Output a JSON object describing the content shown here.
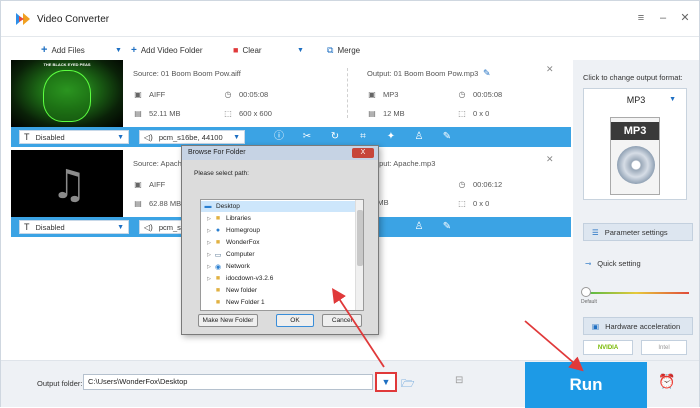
{
  "app": {
    "title": "Video Converter"
  },
  "window_controls": {
    "menu": "≡",
    "minimize": "–",
    "close": "✕"
  },
  "toolbar": {
    "add_files": "Add Files",
    "add_video_folder": "Add Video Folder",
    "clear": "Clear",
    "merge": "Merge"
  },
  "items": [
    {
      "source": "Source: 01 Boom Boom Pow.aiff",
      "src_format": "AIFF",
      "src_duration": "00:05:08",
      "src_size": "52.11 MB",
      "src_resolution": "600 x 600",
      "output": "Output: 01 Boom Boom Pow.mp3",
      "out_format": "MP3",
      "out_duration": "00:05:08",
      "out_size": "12 MB",
      "out_resolution": "0 x 0",
      "subtitle": "Disabled",
      "audio": "pcm_s16be, 44100"
    },
    {
      "source": "Source: Apache",
      "src_format": "AIFF",
      "src_size": "62.88 MB",
      "output": "Output: Apache.mp3",
      "out_size": "14 MB",
      "out_duration": "00:06:12",
      "out_resolution": "0 x 0",
      "subtitle": "Disabled",
      "audio": "pcm_s16b"
    }
  ],
  "thumb1_text": "THE BLACK EYED PEAS",
  "right_panel": {
    "label": "Click to change output format:",
    "format": "MP3",
    "parameter_settings": "Parameter settings",
    "quick_setting": "Quick setting",
    "default": "Default",
    "hardware_acceleration": "Hardware acceleration",
    "nvidia": "NVIDIA",
    "intel": "Intel"
  },
  "bottom": {
    "output_folder_label": "Output folder:",
    "output_folder_value": "C:\\Users\\WonderFox\\Desktop",
    "run": "Run"
  },
  "dialog": {
    "title": "Browse For Folder",
    "close": "X",
    "prompt": "Please select path:",
    "tree": [
      {
        "label": "Desktop",
        "indent": 0,
        "selected": true,
        "icon": "desktop-icon"
      },
      {
        "label": "Libraries",
        "indent": 1,
        "icon": "folder-icon"
      },
      {
        "label": "Homegroup",
        "indent": 1,
        "icon": "homegroup-icon"
      },
      {
        "label": "WonderFox",
        "indent": 1,
        "icon": "user-icon"
      },
      {
        "label": "Computer",
        "indent": 1,
        "icon": "computer-icon"
      },
      {
        "label": "Network",
        "indent": 1,
        "icon": "network-icon"
      },
      {
        "label": "idocdown-v3.2.6",
        "indent": 1,
        "icon": "folder-icon"
      },
      {
        "label": "New folder",
        "indent": 1,
        "icon": "folder-icon"
      },
      {
        "label": "New Folder 1",
        "indent": 1,
        "icon": "folder-icon"
      }
    ],
    "make_new_folder": "Make New Folder",
    "ok": "OK",
    "cancel": "Cancel"
  },
  "colors": {
    "accent_blue": "#3ba3e4",
    "run_blue": "#1d9ae6",
    "highlight_red": "#e0393a"
  }
}
